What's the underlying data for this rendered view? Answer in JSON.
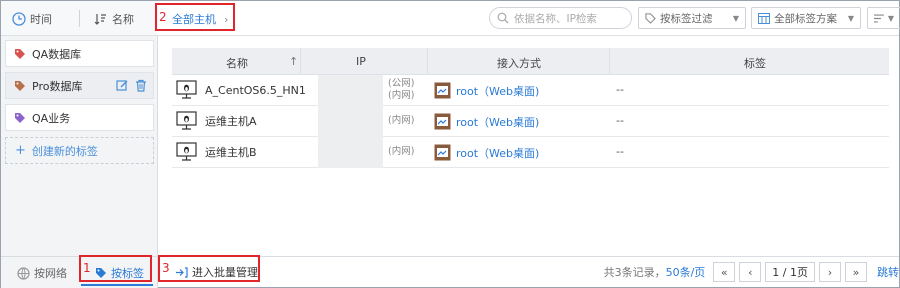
{
  "sidebar": {
    "sort": {
      "time_label": "时间",
      "name_label": "名称"
    },
    "tags": [
      {
        "label": "QA数据库",
        "color": "#d9534f"
      },
      {
        "label": "Pro数据库",
        "color": "#b8704a"
      },
      {
        "label": "QA业务",
        "color": "#8e63c9"
      }
    ],
    "create_label": "创建新的标签"
  },
  "topbar": {
    "breadcrumb": "全部主机",
    "search_placeholder": "依据名称、IP检索",
    "tag_filter": "按标签过滤",
    "tag_scheme": "全部标签方案"
  },
  "table": {
    "columns": [
      "名称",
      "IP",
      "接入方式",
      "标签"
    ],
    "rows": [
      {
        "name": "A_CentOS6.5_HN1",
        "ip_tags": [
          "(公网)",
          "(内网)"
        ],
        "access": "root（Web桌面)",
        "label": "--"
      },
      {
        "name": "运维主机A",
        "ip_tags": [
          "(内网)"
        ],
        "access": "root（Web桌面)",
        "label": "--"
      },
      {
        "name": "运维主机B",
        "ip_tags": [
          "(内网)"
        ],
        "access": "root（Web桌面)",
        "label": "--"
      }
    ]
  },
  "bottom": {
    "tab_network": "按网络",
    "tab_tag": "按标签",
    "batch_label": "进入批量管理",
    "pager_total": "共3条记录，",
    "pager_size": "50条/页",
    "page_display": "1 / 1页",
    "jump_label": "跳转"
  },
  "annotations": [
    "1",
    "2",
    "3"
  ],
  "colors": {
    "accent": "#2a7ad6",
    "annotation": "#e0262b"
  }
}
